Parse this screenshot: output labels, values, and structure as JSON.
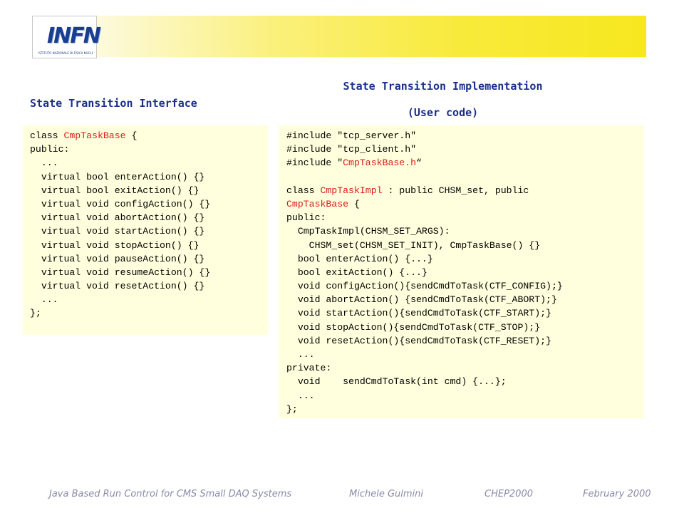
{
  "header": {
    "logo_text": "INFN",
    "logo_caption": "ISTITUTO NAZIONALE DI FISICA NUCLEARE"
  },
  "headings": {
    "interface": "State Transition Interface",
    "implementation_line1": "State Transition Implementation",
    "implementation_line2": "(User code)"
  },
  "code_interface": [
    [
      {
        "t": "class "
      },
      {
        "t": "CmpTaskBase",
        "hl": true
      },
      {
        "t": " {"
      }
    ],
    [
      {
        "t": "public:"
      }
    ],
    [
      {
        "t": "  ..."
      }
    ],
    [
      {
        "t": "  virtual bool enterAction() {}"
      }
    ],
    [
      {
        "t": "  virtual bool exitAction() {}"
      }
    ],
    [
      {
        "t": "  virtual void configAction() {}"
      }
    ],
    [
      {
        "t": "  virtual void abortAction() {}"
      }
    ],
    [
      {
        "t": "  virtual void startAction() {}"
      }
    ],
    [
      {
        "t": "  virtual void stopAction() {}"
      }
    ],
    [
      {
        "t": "  virtual void pauseAction() {}"
      }
    ],
    [
      {
        "t": "  virtual void resumeAction() {}"
      }
    ],
    [
      {
        "t": "  virtual void resetAction() {}"
      }
    ],
    [
      {
        "t": "  ..."
      }
    ],
    [
      {
        "t": "};"
      }
    ]
  ],
  "code_implementation": [
    [
      {
        "t": "#include \"tcp_server.h\""
      }
    ],
    [
      {
        "t": "#include \"tcp_client.h\""
      }
    ],
    [
      {
        "t": "#include \""
      },
      {
        "t": "CmpTaskBase.h",
        "hl": true
      },
      {
        "t": "“"
      }
    ],
    [
      {
        "t": ""
      }
    ],
    [
      {
        "t": "class "
      },
      {
        "t": "CmpTaskImpl",
        "hl": true
      },
      {
        "t": " : public CHSM_set, public"
      }
    ],
    [
      {
        "t": "CmpTaskBase",
        "hl": true
      },
      {
        "t": " {"
      }
    ],
    [
      {
        "t": "public:"
      }
    ],
    [
      {
        "t": "  CmpTaskImpl(CHSM_SET_ARGS):"
      }
    ],
    [
      {
        "t": "    CHSM_set(CHSM_SET_INIT), CmpTaskBase() {}"
      }
    ],
    [
      {
        "t": "  bool enterAction() {...}"
      }
    ],
    [
      {
        "t": "  bool exitAction() {...}"
      }
    ],
    [
      {
        "t": "  void configAction(){sendCmdToTask(CTF_CONFIG);}"
      }
    ],
    [
      {
        "t": "  void abortAction() {sendCmdToTask(CTF_ABORT);}"
      }
    ],
    [
      {
        "t": "  void startAction(){sendCmdToTask(CTF_START);}"
      }
    ],
    [
      {
        "t": "  void stopAction(){sendCmdToTask(CTF_STOP);}"
      }
    ],
    [
      {
        "t": "  void resetAction(){sendCmdToTask(CTF_RESET);}"
      }
    ],
    [
      {
        "t": "  ..."
      }
    ],
    [
      {
        "t": "private:"
      }
    ],
    [
      {
        "t": "  void    sendCmdToTask(int cmd) {...};"
      }
    ],
    [
      {
        "t": "  ..."
      }
    ],
    [
      {
        "t": "};"
      }
    ]
  ],
  "footer": {
    "title": "Java Based Run Control for CMS Small DAQ Systems",
    "author": "Michele Gulmini",
    "conference": "CHEP2000",
    "date": "February 2000"
  },
  "colors": {
    "heading": "#1b2f8a",
    "highlight": "#d81b1b",
    "code_background": "#ffffdd",
    "banner": "#f7e71f"
  }
}
